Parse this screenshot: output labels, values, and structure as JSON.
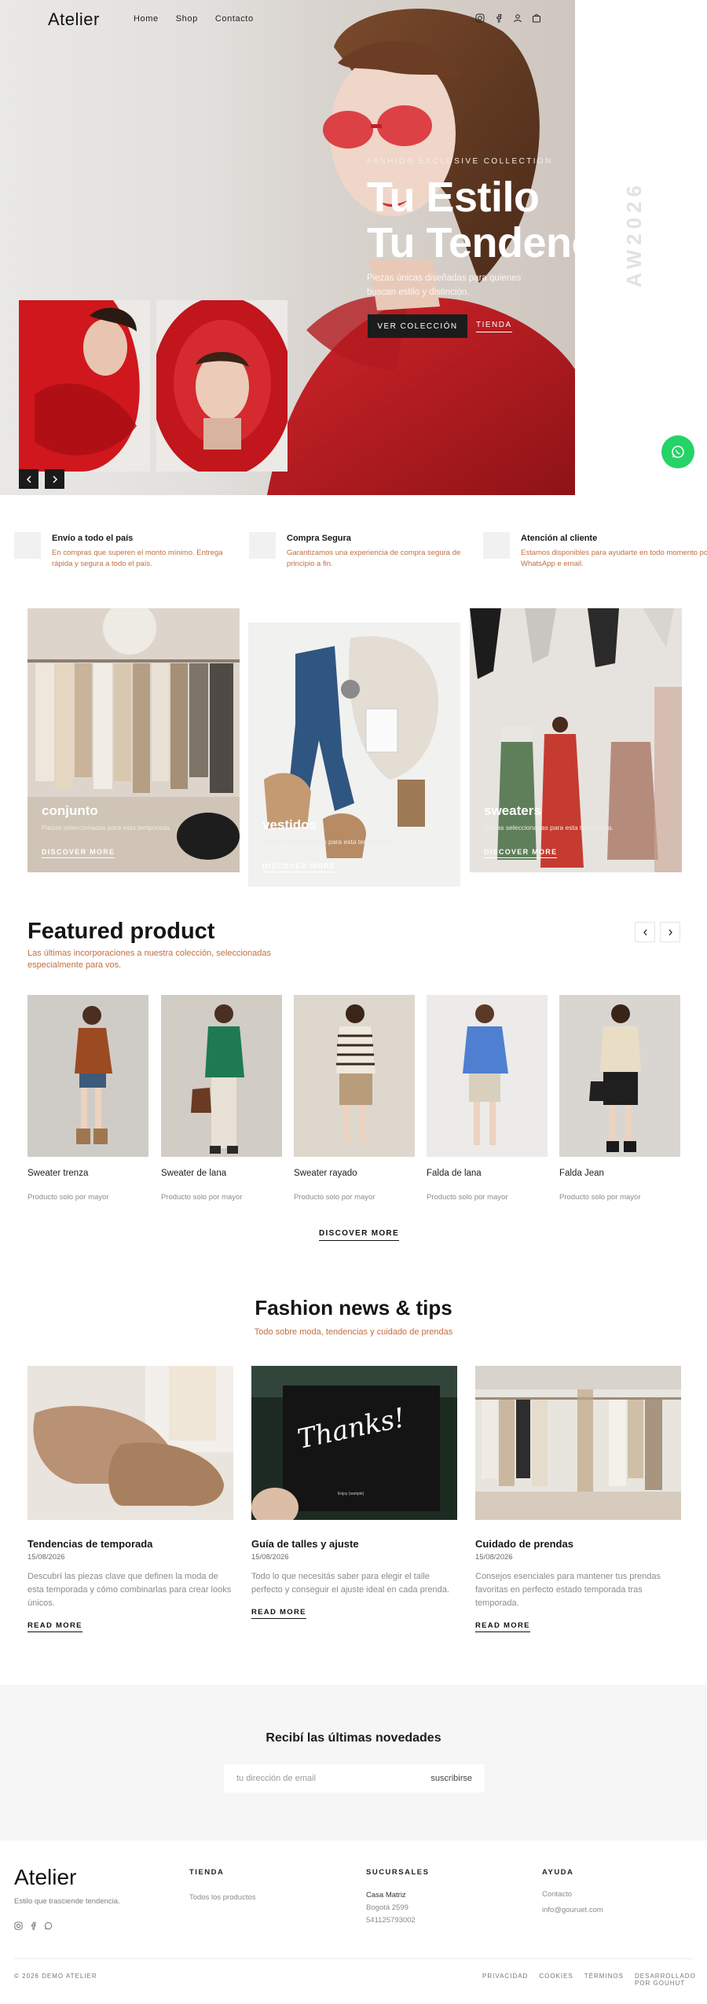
{
  "header": {
    "logo": "Atelier",
    "nav": [
      "Home",
      "Shop",
      "Contacto"
    ]
  },
  "icons": {
    "instagram": "instagram-icon",
    "facebook": "facebook-icon",
    "user": "user-icon",
    "cart": "cart-icon",
    "whatsapp": "whatsapp-icon",
    "arrow_left": "chevron-left-icon",
    "arrow_right": "chevron-right-icon"
  },
  "hero": {
    "eyebrow": "FASHION EXCLUSIVE COLLECTION",
    "title": "Tu Estilo\nTu Tendencia",
    "subtitle": "Piezas únicas diseñadas para quienes buscan estilo y distinción.",
    "primary_button": "VER COLECCIÓN",
    "secondary_link": "TIENDA",
    "vertical_text": "AW2026"
  },
  "features": [
    {
      "title": "Envío a todo el país",
      "text": "En compras que superen el monto mínimo. Entrega rápida y segura a todo el país."
    },
    {
      "title": "Compra Segura",
      "text": "Garantizamos una experiencia de compra segura de principio a fin."
    },
    {
      "title": "Atención al cliente",
      "text": "Estamos disponibles para ayudarte en todo momento por WhatsApp e email."
    }
  ],
  "categories": [
    {
      "label": "conjunto",
      "text": "Piezas seleccionadas para esta temporada.",
      "link": "DISCOVER MORE"
    },
    {
      "label": "vestidos",
      "text": "Piezas seleccionadas para esta temporada.",
      "link": "DISCOVER MORE"
    },
    {
      "label": "sweaters",
      "text": "Piezas seleccionadas para esta temporada.",
      "link": "DISCOVER MORE"
    }
  ],
  "featured": {
    "title": "Featured product",
    "subtitle": "Las últimas incorporaciones a nuestra colección, seleccionadas especialmente para vos.",
    "products": [
      {
        "name": "Sweater trenza",
        "note": "Producto solo por mayor"
      },
      {
        "name": "Sweater de lana",
        "note": "Producto solo por mayor"
      },
      {
        "name": "Sweater rayado",
        "note": "Producto solo por mayor"
      },
      {
        "name": "Falda de lana",
        "note": "Producto solo por mayor"
      },
      {
        "name": "Falda Jean",
        "note": "Producto solo por mayor"
      }
    ],
    "discover": "DISCOVER MORE"
  },
  "news": {
    "title": "Fashion news & tips",
    "subtitle": "Todo sobre moda, tendencias y cuidado de prendas",
    "posts": [
      {
        "title": "Tendencias de temporada",
        "date": "15/08/2026",
        "text": "Descubrí las piezas clave que definen la moda de esta temporada y cómo combinarlas para crear looks únicos.",
        "link": "READ MORE"
      },
      {
        "title": "Guía de talles y ajuste",
        "date": "15/08/2026",
        "text": "Todo lo que necesitás saber para elegir el talle perfecto y conseguir el ajuste ideal en cada prenda.",
        "link": "READ MORE",
        "card_text": "Thanks!",
        "card_small": "Enjoy (sample)"
      },
      {
        "title": "Cuidado de prendas",
        "date": "15/08/2026",
        "text": "Consejos esenciales para mantener tus prendas favoritas en perfecto estado temporada tras temporada.",
        "link": "READ MORE"
      }
    ]
  },
  "newsletter": {
    "title": "Recibí las últimas novedades",
    "placeholder": "tu dirección de email",
    "button": "suscribirse"
  },
  "footer": {
    "logo": "Atelier",
    "tagline": "Estilo que trasciende tendencia.",
    "columns": [
      {
        "heading": "TIENDA",
        "items": [
          "Todos los productos"
        ]
      },
      {
        "heading": "SUCURSALES",
        "items": [
          "Casa Matriz",
          "Bogotá 2599",
          "541125793002"
        ]
      },
      {
        "heading": "AYUDA",
        "items": [
          "Contacto",
          "info@gouruet.com"
        ]
      }
    ],
    "copyright": "© 2026 DEMO ATELIER",
    "legal": [
      "PRIVACIDAD",
      "COOKIES",
      "TÉRMINOS",
      "DESARROLLADO POR GOUHUT"
    ]
  },
  "colors": {
    "accent": "#c46d3f",
    "dark": "#1c1c1c",
    "whatsapp": "#25d366",
    "hero_red": "#c81e23"
  }
}
